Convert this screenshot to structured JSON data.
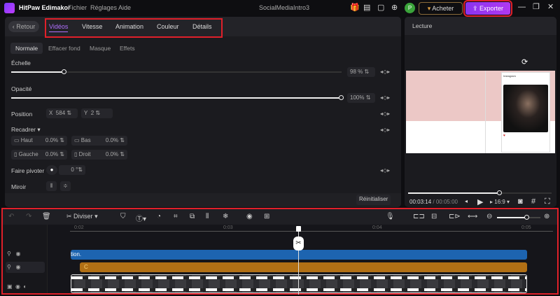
{
  "app": {
    "name": "HitPaw Edimakor",
    "menu": [
      "Fichier",
      "Réglages",
      "Aide"
    ],
    "project_title": "SocialMediaIntro3",
    "avatar_letter": "P",
    "buy_label": "Acheter",
    "export_label": "Exporter"
  },
  "editor": {
    "back_label": "Retour",
    "tabs": [
      "Vidéos",
      "Vitesse",
      "Animation",
      "Couleur",
      "Détails"
    ],
    "subtabs": [
      "Normale",
      "Effacer fond",
      "Masque",
      "Effets"
    ],
    "scale": {
      "label": "Échelle",
      "value": "98 %",
      "percent": 98
    },
    "opacity": {
      "label": "Opacité",
      "value": "100%",
      "percent": 100
    },
    "position": {
      "label": "Position",
      "x_label": "X",
      "x": "584",
      "y_label": "Y",
      "y": "2"
    },
    "crop": {
      "label": "Recadrer",
      "haut": "Haut",
      "haut_v": "0.0%",
      "bas": "Bas",
      "bas_v": "0.0%",
      "gauche": "Gauche",
      "gauche_v": "0.0%",
      "droit": "Droit",
      "droit_v": "0.0%"
    },
    "rotate": {
      "label": "Faire pivoter",
      "value": "0",
      "unit": "°"
    },
    "mirror": {
      "label": "Miroir"
    },
    "reset_label": "Réinitialiser"
  },
  "player": {
    "title": "Lecture",
    "current": "00:03:14",
    "total": "/ 00:05:00",
    "progress": 0.64,
    "ratio": "16:9",
    "ig_name": "Instagram"
  },
  "timeline": {
    "split_label": "Diviser",
    "ticks": [
      "0:02",
      "0:03",
      "0:04",
      "0:05"
    ],
    "text_clip": "tion.",
    "audio_clip": "C",
    "zoom": 0.7
  }
}
